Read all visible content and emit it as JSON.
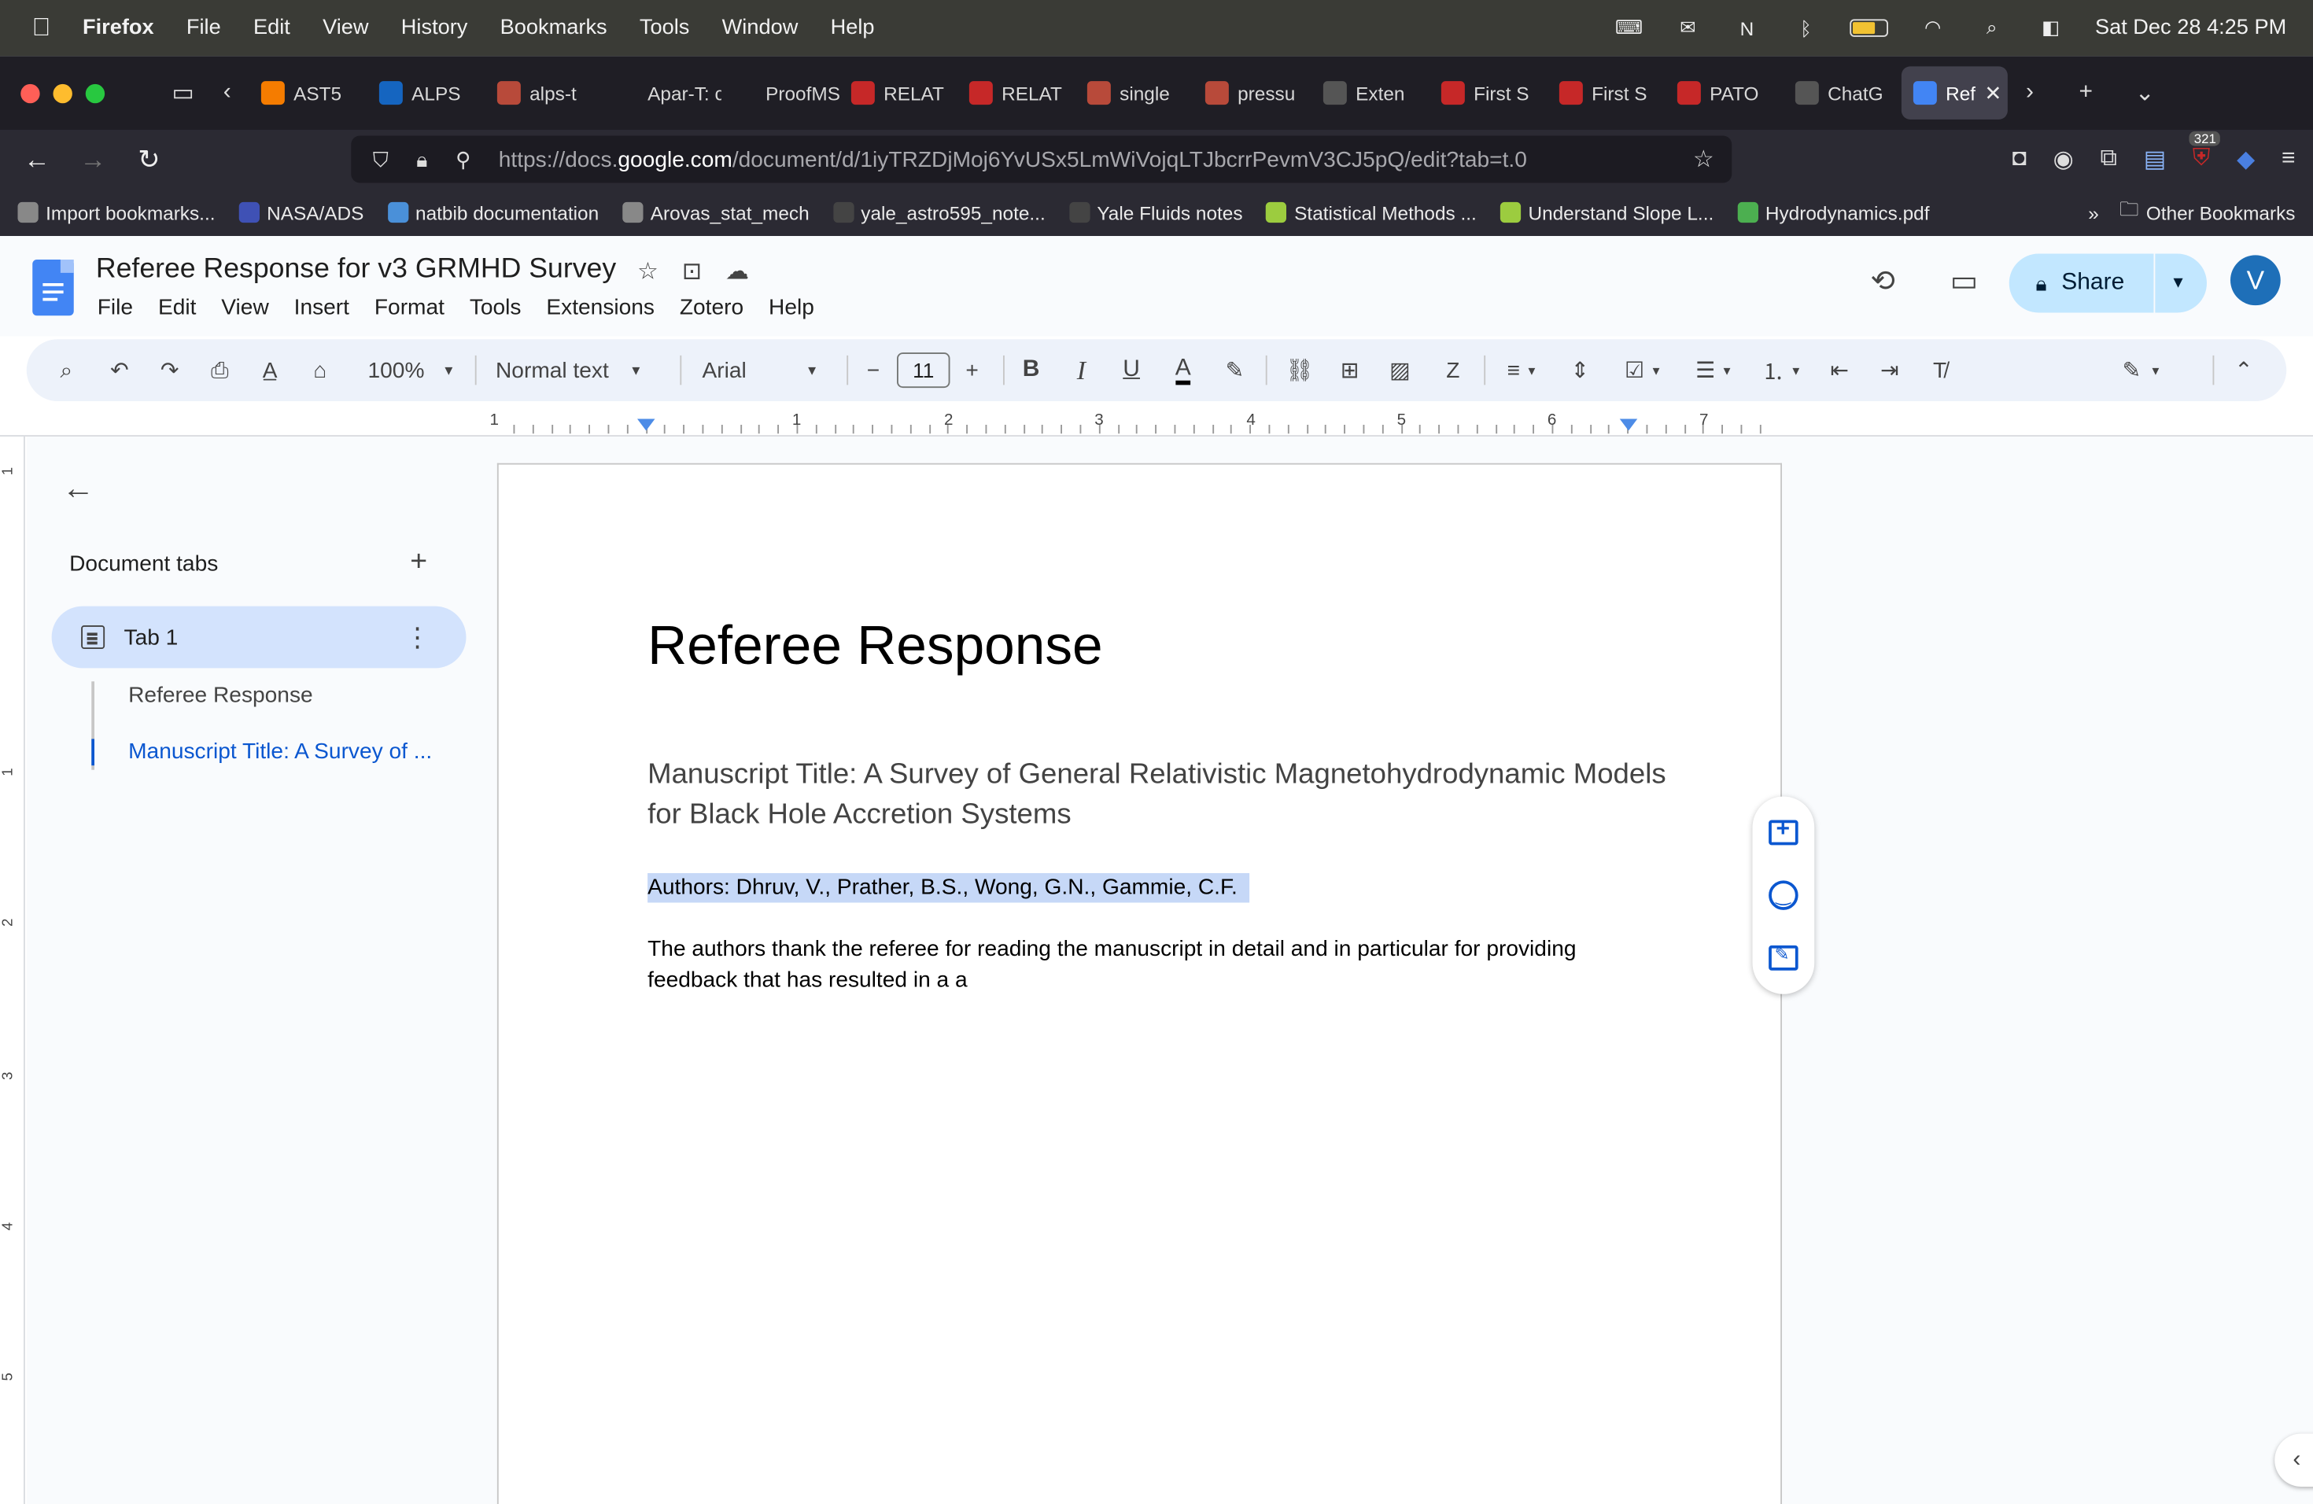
{
  "macbar": {
    "app": "Firefox",
    "menus": [
      "File",
      "Edit",
      "View",
      "History",
      "Bookmarks",
      "Tools",
      "Window",
      "Help"
    ],
    "datetime": "Sat Dec 28  4:25 PM"
  },
  "tabs": [
    {
      "label": "AST5",
      "color": "#f57c00"
    },
    {
      "label": "ALPS",
      "color": "#1565c0"
    },
    {
      "label": "alps-t",
      "color": "#b84a3a"
    },
    {
      "label": "Apar-T: cc",
      "color": ""
    },
    {
      "label": "ProofMS.p",
      "color": ""
    },
    {
      "label": "RELAT",
      "color": "#c62828"
    },
    {
      "label": "RELAT",
      "color": "#c62828"
    },
    {
      "label": "single",
      "color": "#b84a3a"
    },
    {
      "label": "pressu",
      "color": "#b84a3a"
    },
    {
      "label": "Exten",
      "color": "#555555"
    },
    {
      "label": "First S",
      "color": "#c62828"
    },
    {
      "label": "First S",
      "color": "#c62828"
    },
    {
      "label": "PATO",
      "color": "#c62828"
    },
    {
      "label": "ChatG",
      "color": "#555555"
    },
    {
      "label": "Ref",
      "color": "#4285f4"
    }
  ],
  "navbar": {
    "url_prefix": "https://docs.",
    "url_domain": "google.com",
    "url_path": "/document/d/1iyTRZDjMoj6YvUSx5LmWiVojqLTJbcrrPevmV3CJ5pQ/edit?tab=t.0",
    "badge": "321"
  },
  "bookmarks": [
    {
      "label": "Import bookmarks...",
      "color": "#888888"
    },
    {
      "label": "NASA/ADS",
      "color": "#3f51b5"
    },
    {
      "label": "natbib documentation",
      "color": "#4a90d9"
    },
    {
      "label": "Arovas_stat_mech",
      "color": "#888888"
    },
    {
      "label": "yale_astro595_note...",
      "color": "#444444"
    },
    {
      "label": "Yale Fluids notes",
      "color": "#444444"
    },
    {
      "label": "Statistical Methods ...",
      "color": "#9ccc3f"
    },
    {
      "label": "Understand Slope L...",
      "color": "#9ccc3f"
    },
    {
      "label": "Hydrodynamics.pdf",
      "color": "#4caf50"
    }
  ],
  "bookmarks_other": "Other Bookmarks",
  "doc": {
    "title": "Referee Response for v3 GRMHD Survey",
    "menus": [
      "File",
      "Edit",
      "View",
      "Insert",
      "Format",
      "Tools",
      "Extensions",
      "Zotero",
      "Help"
    ],
    "share_label": "Share",
    "avatar_letter": "V"
  },
  "toolbar": {
    "zoom": "100%",
    "style": "Normal text",
    "font": "Arial",
    "font_size": "11"
  },
  "ruler": {
    "numbers": [
      "1",
      "1",
      "2",
      "3",
      "4",
      "5",
      "6",
      "7"
    ],
    "vnumbers": [
      "1",
      "1",
      "2",
      "3",
      "4",
      "5"
    ]
  },
  "sidebar": {
    "title": "Document tabs",
    "tab_label": "Tab 1",
    "outline": [
      "Referee Response",
      "Manuscript Title: A Survey of ..."
    ]
  },
  "page": {
    "heading": "Referee Response",
    "subtitle": "Manuscript Title: A Survey of General Relativistic Magnetohydrodynamic Models for Black Hole Accretion Systems",
    "authors": "Authors: Dhruv, V., Prather, B.S., Wong, G.N., Gammie, C.F.",
    "body": "The authors thank the referee for reading the manuscript in detail and in particular for providing feedback that has resulted in a a"
  }
}
